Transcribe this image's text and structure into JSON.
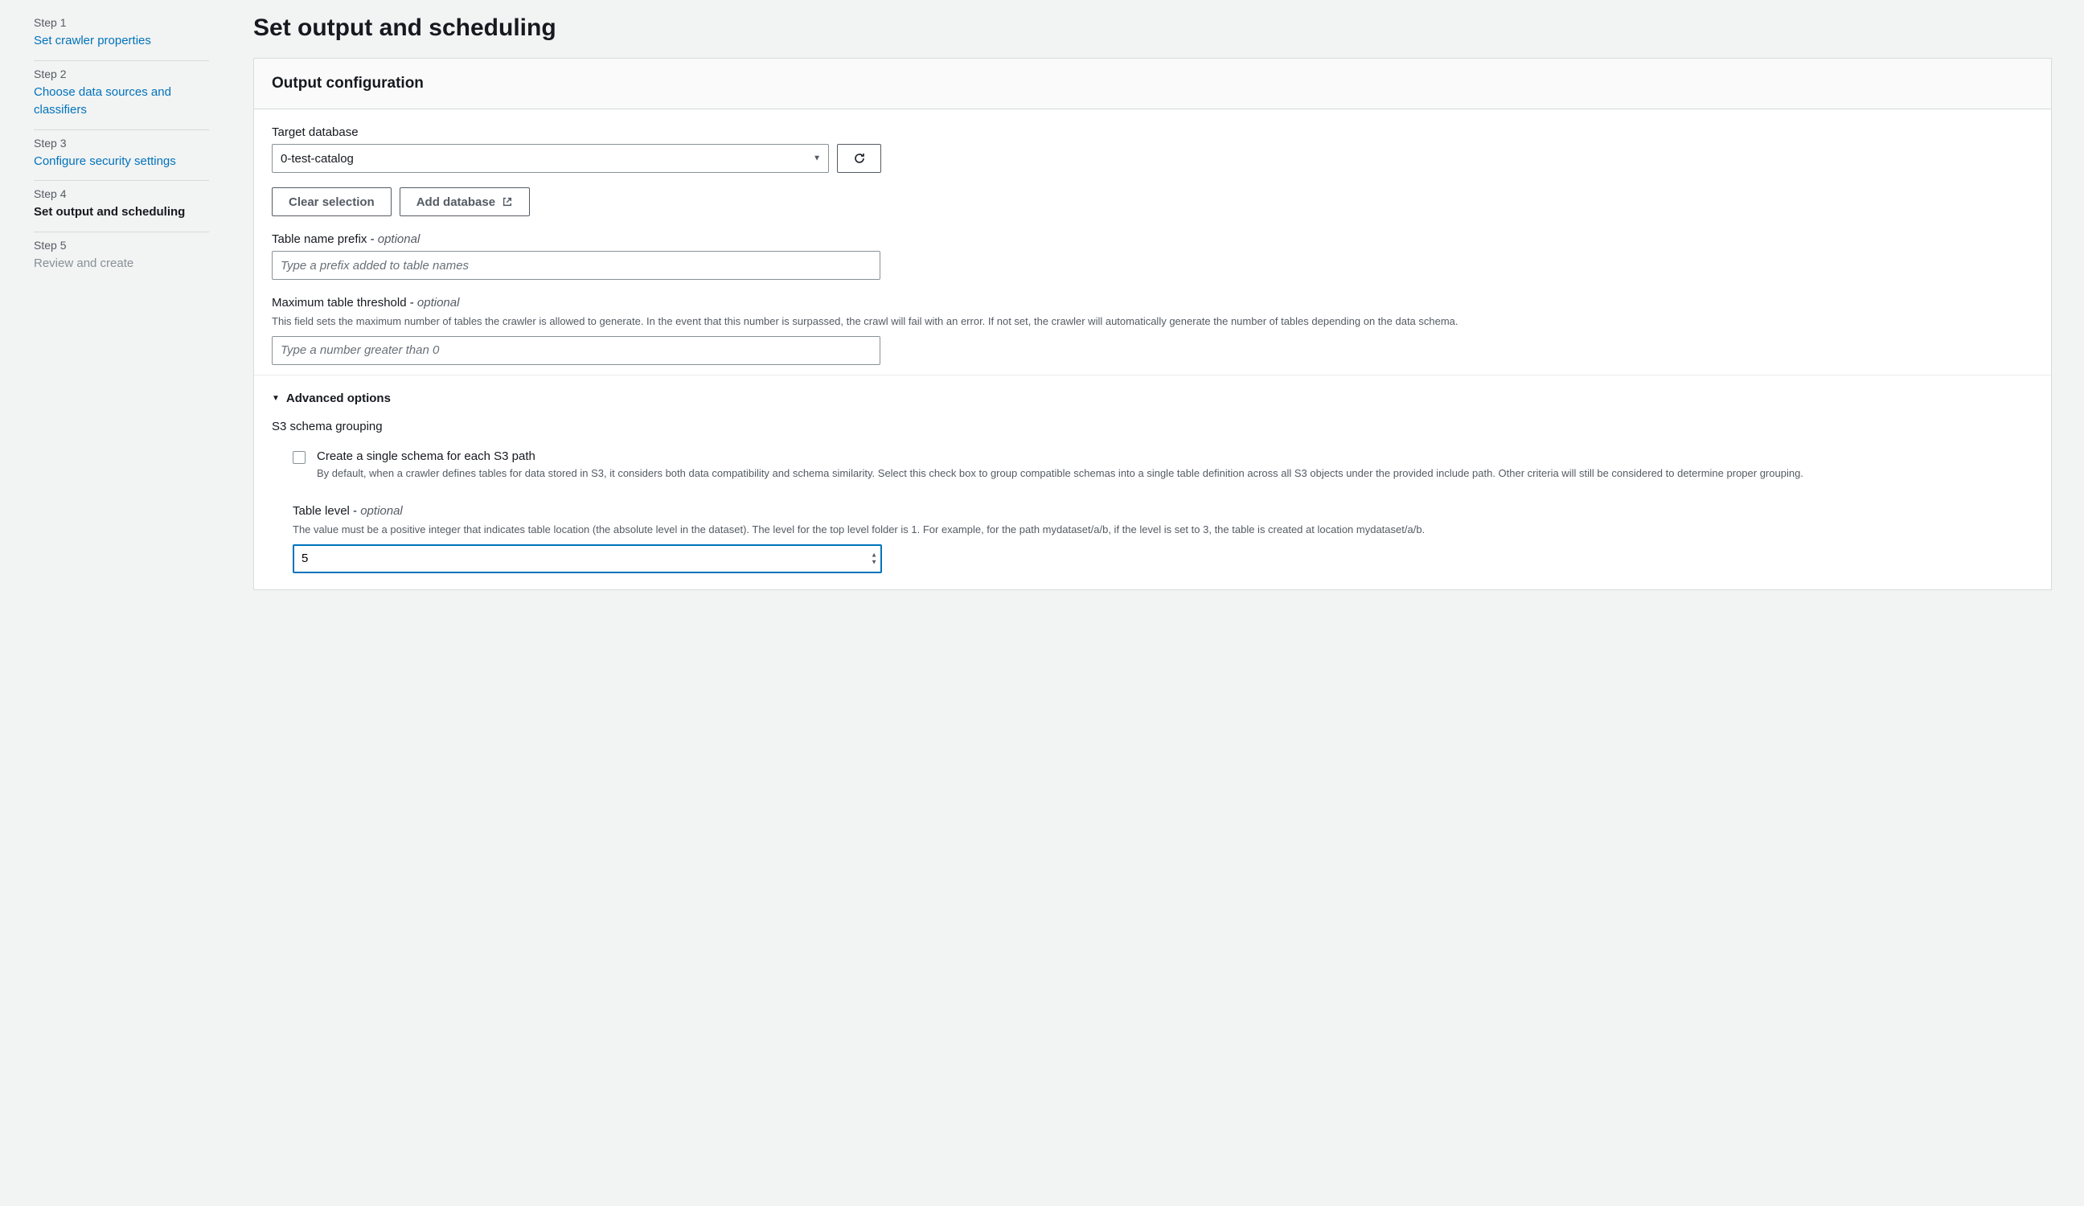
{
  "sidebar": {
    "steps": [
      {
        "label": "Step 1",
        "title": "Set crawler properties"
      },
      {
        "label": "Step 2",
        "title": "Choose data sources and classifiers"
      },
      {
        "label": "Step 3",
        "title": "Configure security settings"
      },
      {
        "label": "Step 4",
        "title": "Set output and scheduling"
      },
      {
        "label": "Step 5",
        "title": "Review and create"
      }
    ]
  },
  "page": {
    "title": "Set output and scheduling"
  },
  "output": {
    "panel_title": "Output configuration",
    "target_db": {
      "label": "Target database",
      "value": "0-test-catalog",
      "clear_label": "Clear selection",
      "add_label": "Add database"
    },
    "prefix": {
      "label_main": "Table name prefix - ",
      "label_optional": "optional",
      "placeholder": "Type a prefix added to table names",
      "value": ""
    },
    "threshold": {
      "label_main": "Maximum table threshold - ",
      "label_optional": "optional",
      "hint": "This field sets the maximum number of tables the crawler is allowed to generate. In the event that this number is surpassed, the crawl will fail with an error. If not set, the crawler will automatically generate the number of tables depending on the data schema.",
      "placeholder": "Type a number greater than 0",
      "value": ""
    }
  },
  "advanced": {
    "title": "Advanced options",
    "s3_grouping": {
      "heading": "S3 schema grouping",
      "checkbox_label": "Create a single schema for each S3 path",
      "checkbox_hint": "By default, when a crawler defines tables for data stored in S3, it considers both data compatibility and schema similarity. Select this check box to group compatible schemas into a single table definition across all S3 objects under the provided include path. Other criteria will still be considered to determine proper grouping.",
      "table_level": {
        "label_main": "Table level - ",
        "label_optional": "optional",
        "hint": "The value must be a positive integer that indicates table location (the absolute level in the dataset). The level for the top level folder is 1. For example, for the path mydataset/a/b, if the level is set to 3, the table is created at location mydataset/a/b.",
        "value": "5"
      }
    }
  }
}
